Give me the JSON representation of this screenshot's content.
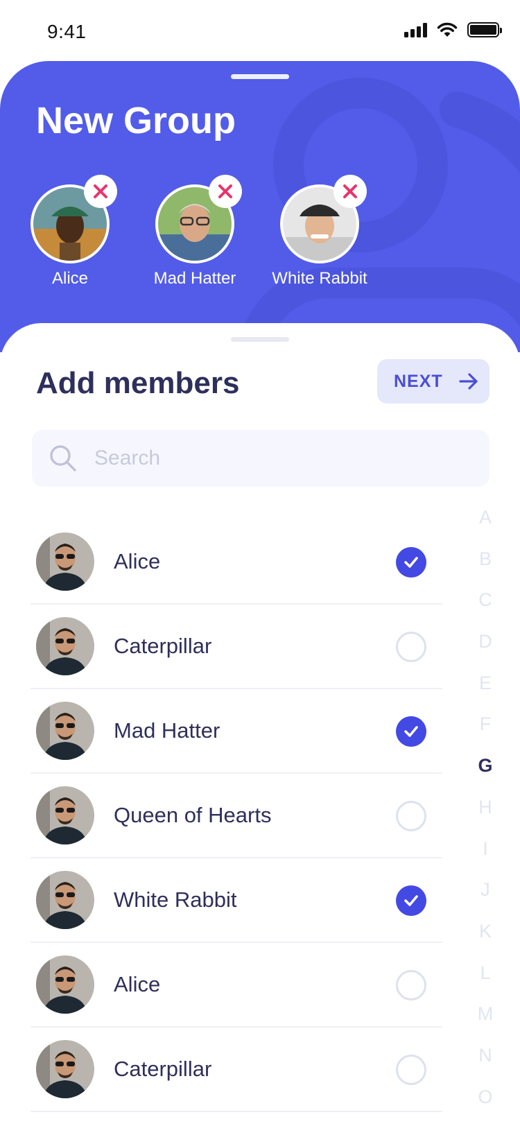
{
  "status_bar": {
    "time": "9:41"
  },
  "header": {
    "title": "New Group",
    "selected_members": [
      {
        "name": "Alice",
        "remove_icon": "close-icon"
      },
      {
        "name": "Mad Hatter",
        "remove_icon": "close-icon"
      },
      {
        "name": "White Rabbit",
        "remove_icon": "close-icon"
      }
    ]
  },
  "sheet": {
    "title": "Add members",
    "next_label": "NEXT",
    "search": {
      "placeholder": "Search",
      "value": ""
    },
    "contacts": [
      {
        "name": "Alice",
        "selected": true
      },
      {
        "name": "Caterpillar",
        "selected": false
      },
      {
        "name": "Mad Hatter",
        "selected": true
      },
      {
        "name": "Queen of Hearts",
        "selected": false
      },
      {
        "name": "White Rabbit",
        "selected": true
      },
      {
        "name": "Alice",
        "selected": false
      },
      {
        "name": "Caterpillar",
        "selected": false
      }
    ],
    "alphabet_index": [
      "A",
      "B",
      "C",
      "D",
      "E",
      "F",
      "G",
      "H",
      "I",
      "J",
      "K",
      "L",
      "M",
      "N",
      "O"
    ],
    "active_letter": "G"
  },
  "colors": {
    "accent": "#525ce9",
    "check": "#4349e3",
    "text_dark": "#2e2f5b",
    "remove_x": "#e8336b"
  }
}
